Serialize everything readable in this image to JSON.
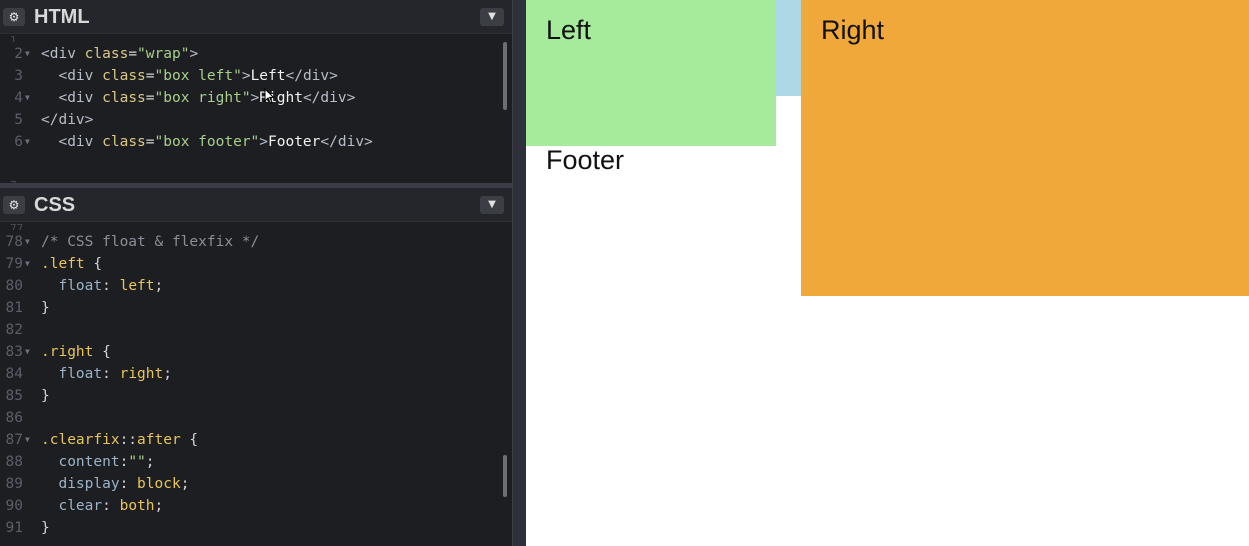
{
  "colors": {
    "editor_bg": "#1d1e22",
    "wrap": "#add8e6",
    "left": "#a6eb9b",
    "right": "#f1a83b"
  },
  "html_panel": {
    "gear_icon": "⚙",
    "title": "HTML",
    "collapse_icon": "chevron-down-icon",
    "lines": [
      {
        "n": "2",
        "fold": true,
        "code": [
          [
            "tag",
            "<div "
          ],
          [
            "attr",
            "class"
          ],
          [
            "punc",
            "="
          ],
          [
            "str",
            "\"wrap\""
          ],
          [
            "tag",
            ">"
          ]
        ]
      },
      {
        "n": "3",
        "fold": false,
        "code": [
          [
            "punc",
            "  "
          ],
          [
            "tag",
            "<div "
          ],
          [
            "attr",
            "class"
          ],
          [
            "punc",
            "="
          ],
          [
            "str",
            "\"box left\""
          ],
          [
            "tag",
            ">"
          ],
          [
            "txt",
            "Left"
          ],
          [
            "tag",
            "</div>"
          ]
        ]
      },
      {
        "n": "4",
        "fold": true,
        "code": [
          [
            "punc",
            "  "
          ],
          [
            "tag",
            "<div "
          ],
          [
            "attr",
            "class"
          ],
          [
            "punc",
            "="
          ],
          [
            "str",
            "\"box right\""
          ],
          [
            "tag",
            ">"
          ],
          [
            "txt",
            "Right"
          ],
          [
            "tag",
            "</div>"
          ]
        ]
      },
      {
        "n": "5",
        "fold": false,
        "code": [
          [
            "tag",
            "</div>"
          ]
        ]
      },
      {
        "n": "6",
        "fold": true,
        "code": [
          [
            "punc",
            "  "
          ],
          [
            "tag",
            "<div "
          ],
          [
            "attr",
            "class"
          ],
          [
            "punc",
            "="
          ],
          [
            "str",
            "\"box footer\""
          ],
          [
            "tag",
            ">"
          ],
          [
            "txt",
            "Footer"
          ],
          [
            "tag",
            "</div>"
          ]
        ]
      }
    ]
  },
  "css_panel": {
    "gear_icon": "⚙",
    "title": "CSS",
    "collapse_icon": "chevron-down-icon",
    "lines": [
      {
        "n": "78",
        "fold": true,
        "code": [
          [
            "comment",
            "/* CSS float & flexfix */"
          ]
        ]
      },
      {
        "n": "79",
        "fold": true,
        "code": [
          [
            "sel",
            ".left"
          ],
          [
            "punc",
            " {"
          ]
        ]
      },
      {
        "n": "80",
        "fold": false,
        "code": [
          [
            "punc",
            "  "
          ],
          [
            "prop",
            "float"
          ],
          [
            "punc",
            ": "
          ],
          [
            "val",
            "left"
          ],
          [
            "punc",
            ";"
          ]
        ]
      },
      {
        "n": "81",
        "fold": false,
        "code": [
          [
            "punc",
            "}"
          ]
        ]
      },
      {
        "n": "82",
        "fold": false,
        "code": [
          [
            "punc",
            ""
          ]
        ]
      },
      {
        "n": "83",
        "fold": true,
        "code": [
          [
            "sel",
            ".right"
          ],
          [
            "punc",
            " {"
          ]
        ]
      },
      {
        "n": "84",
        "fold": false,
        "code": [
          [
            "punc",
            "  "
          ],
          [
            "prop",
            "float"
          ],
          [
            "punc",
            ": "
          ],
          [
            "val",
            "right"
          ],
          [
            "punc",
            ";"
          ]
        ]
      },
      {
        "n": "85",
        "fold": false,
        "code": [
          [
            "punc",
            "}"
          ]
        ]
      },
      {
        "n": "86",
        "fold": false,
        "code": [
          [
            "punc",
            ""
          ]
        ]
      },
      {
        "n": "87",
        "fold": true,
        "code": [
          [
            "sel",
            ".clearfix"
          ],
          [
            "punc",
            "::"
          ],
          [
            "sel",
            "after"
          ],
          [
            "punc",
            " {"
          ]
        ]
      },
      {
        "n": "88",
        "fold": false,
        "code": [
          [
            "punc",
            "  "
          ],
          [
            "prop",
            "content"
          ],
          [
            "punc",
            ":"
          ],
          [
            "str",
            "\"\""
          ],
          [
            "punc",
            ";"
          ]
        ]
      },
      {
        "n": "89",
        "fold": false,
        "code": [
          [
            "punc",
            "  "
          ],
          [
            "prop",
            "display"
          ],
          [
            "punc",
            ": "
          ],
          [
            "val",
            "block"
          ],
          [
            "punc",
            ";"
          ]
        ]
      },
      {
        "n": "90",
        "fold": false,
        "code": [
          [
            "punc",
            "  "
          ],
          [
            "prop",
            "clear"
          ],
          [
            "punc",
            ": "
          ],
          [
            "val",
            "both"
          ],
          [
            "punc",
            ";"
          ]
        ]
      },
      {
        "n": "91",
        "fold": false,
        "code": [
          [
            "punc",
            "}"
          ]
        ]
      }
    ]
  },
  "preview": {
    "left_label": "Left",
    "right_label": "Right",
    "footer_label": "Footer"
  }
}
